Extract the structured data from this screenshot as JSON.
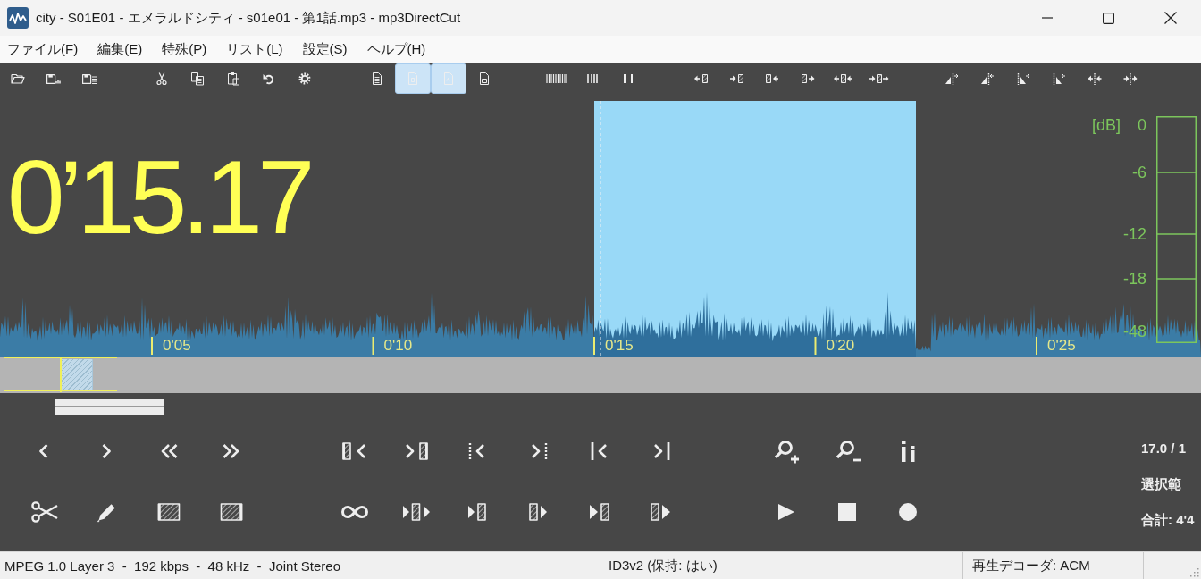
{
  "window": {
    "title": "city - S01E01 - エメラルドシティ - s01e01 - 第1話.mp3 - mp3DirectCut"
  },
  "menu": [
    "ファイル(F)",
    "編集(E)",
    "特殊(P)",
    "リスト(L)",
    "設定(S)",
    "ヘルプ(H)"
  ],
  "toolbar": {
    "groups": [
      [
        {
          "pressed": false
        },
        {
          "pressed": false
        },
        {
          "pressed": false
        }
      ],
      [
        {
          "pressed": false
        },
        {
          "pressed": false
        },
        {
          "pressed": false
        },
        {
          "pressed": false
        },
        {
          "pressed": false
        }
      ],
      [
        {
          "pressed": false
        },
        {
          "pressed": true
        },
        {
          "pressed": true
        },
        {
          "pressed": false
        }
      ],
      [
        {
          "pressed": false
        },
        {
          "pressed": false
        },
        {
          "pressed": false
        }
      ],
      [
        {
          "pressed": false
        },
        {
          "pressed": false
        },
        {
          "pressed": false
        },
        {
          "pressed": false
        },
        {
          "pressed": false
        },
        {
          "pressed": false
        }
      ],
      [
        {
          "pressed": false
        },
        {
          "pressed": false
        },
        {
          "pressed": false
        },
        {
          "pressed": false
        },
        {
          "pressed": false
        },
        {
          "pressed": false
        }
      ]
    ]
  },
  "display": {
    "time": "0’15.17",
    "ruler": [
      "0'05",
      "0'10",
      "0'15",
      "0'20",
      "0'25"
    ],
    "meter": {
      "unit": "[dB]",
      "scale": [
        "0",
        "-6",
        "-12",
        "-18",
        "-48"
      ]
    }
  },
  "info": [
    "17.0 / 1",
    "選択範",
    "合計: 4'4"
  ],
  "status_bar": [
    "MPEG 1.0 Layer 3  -  192 kbps  -  48 kHz  -  Joint Stereo",
    "ID3v2 (保持: はい)",
    "再生デコーダ: ACM"
  ]
}
